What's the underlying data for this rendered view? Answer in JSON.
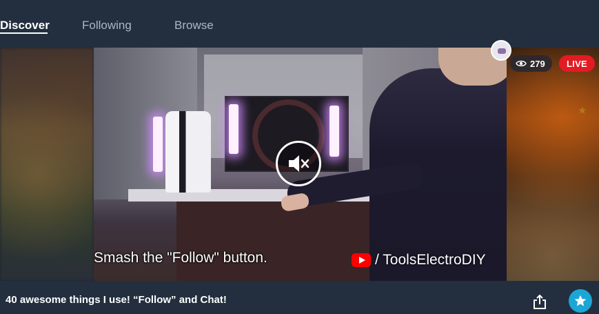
{
  "nav": {
    "tabs": [
      {
        "label": "Discover",
        "active": true
      },
      {
        "label": "Following",
        "active": false
      },
      {
        "label": "Browse",
        "active": false
      }
    ]
  },
  "player": {
    "caption": "Smash the \"Follow\" button.",
    "channel_tag": "/ ToolsElectroDIY",
    "viewer_count": "279",
    "live_label": "LIVE",
    "muted": true
  },
  "stream": {
    "title": "40 awesome things I use! “Follow” and Chat!"
  },
  "icons": {
    "viewers": "eye-icon",
    "mute": "muted-speaker-icon",
    "share": "share-icon",
    "follow": "star-icon",
    "youtube": "youtube-logo-icon"
  },
  "colors": {
    "background": "#232f3e",
    "live": "#e31b23",
    "follow": "#1ba6d6",
    "inactive_tab": "#aeb6c2"
  }
}
